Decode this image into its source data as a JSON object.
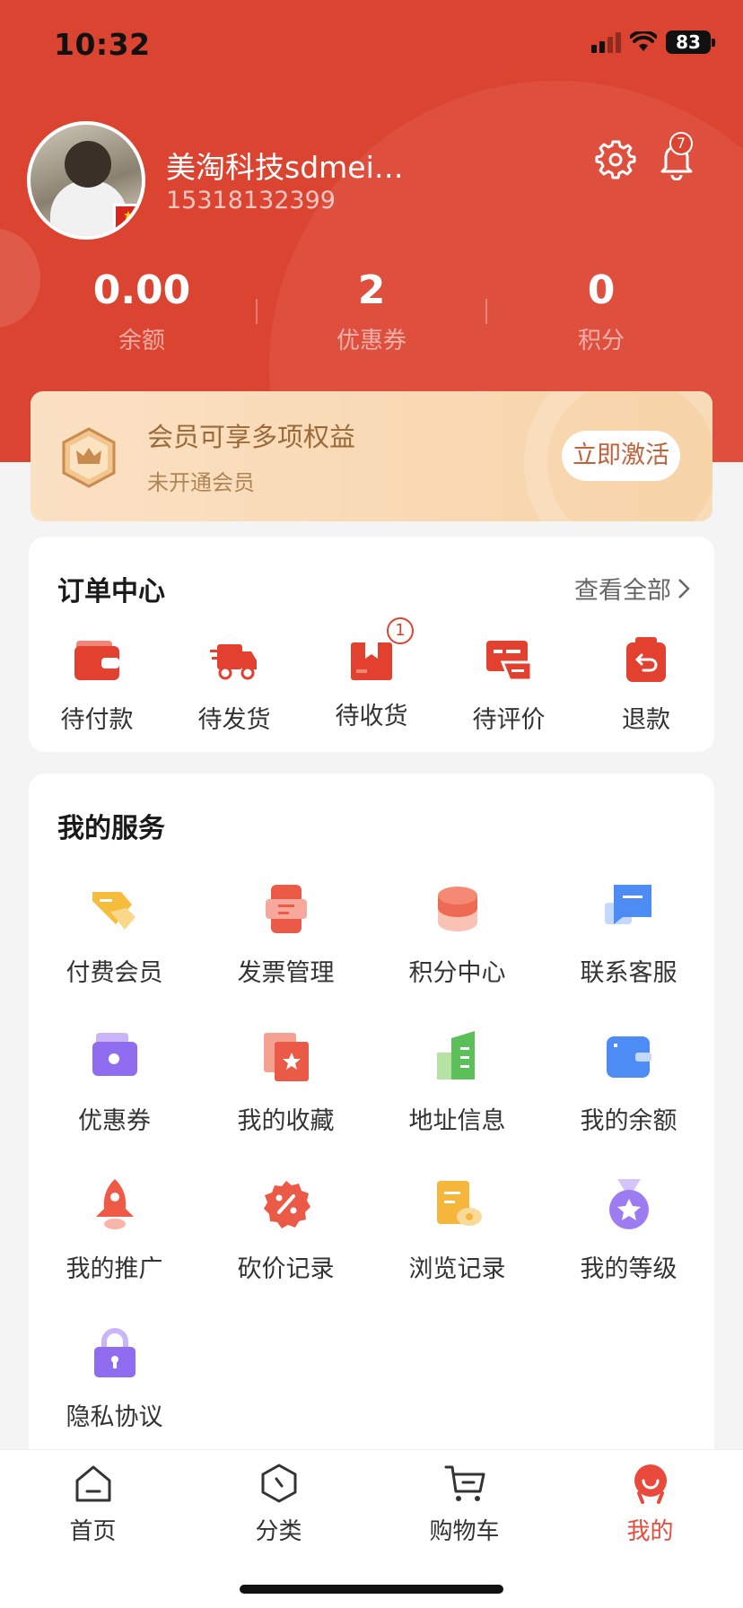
{
  "status_bar": {
    "time": "10:32",
    "battery": "83"
  },
  "profile": {
    "name": "美淘科技sdmei…",
    "phone": "15318132399",
    "notification_count": "7"
  },
  "stats": [
    {
      "value": "0.00",
      "label": "余额"
    },
    {
      "value": "2",
      "label": "优惠券"
    },
    {
      "value": "0",
      "label": "积分"
    }
  ],
  "member": {
    "title": "会员可享多项权益",
    "subtitle": "未开通会员",
    "activate_label": "立即激活"
  },
  "orders": {
    "title": "订单中心",
    "view_all": "查看全部",
    "items": [
      {
        "label": "待付款",
        "icon": "wallet-icon"
      },
      {
        "label": "待发货",
        "icon": "truck-icon"
      },
      {
        "label": "待收货",
        "icon": "box-icon",
        "badge": "1"
      },
      {
        "label": "待评价",
        "icon": "comment-icon"
      },
      {
        "label": "退款",
        "icon": "refund-icon"
      }
    ]
  },
  "services": {
    "title": "我的服务",
    "items": [
      {
        "label": "付费会员",
        "icon": "vip-tag-icon"
      },
      {
        "label": "发票管理",
        "icon": "invoice-icon"
      },
      {
        "label": "积分中心",
        "icon": "coin-stack-icon"
      },
      {
        "label": "联系客服",
        "icon": "chat-icon"
      },
      {
        "label": "优惠券",
        "icon": "coupon-icon"
      },
      {
        "label": "我的收藏",
        "icon": "favorite-icon"
      },
      {
        "label": "地址信息",
        "icon": "building-icon"
      },
      {
        "label": "我的余额",
        "icon": "balance-wallet-icon"
      },
      {
        "label": "我的推广",
        "icon": "rocket-icon"
      },
      {
        "label": "砍价记录",
        "icon": "discount-icon"
      },
      {
        "label": "浏览记录",
        "icon": "history-icon"
      },
      {
        "label": "我的等级",
        "icon": "medal-icon"
      },
      {
        "label": "隐私协议",
        "icon": "lock-icon"
      }
    ]
  },
  "tabs": [
    {
      "label": "首页",
      "icon": "home-icon"
    },
    {
      "label": "分类",
      "icon": "category-icon"
    },
    {
      "label": "购物车",
      "icon": "cart-icon"
    },
    {
      "label": "我的",
      "icon": "profile-icon",
      "active": true
    }
  ],
  "colors": {
    "brand": "#dc4432",
    "active_tab": "#e94a3c"
  }
}
